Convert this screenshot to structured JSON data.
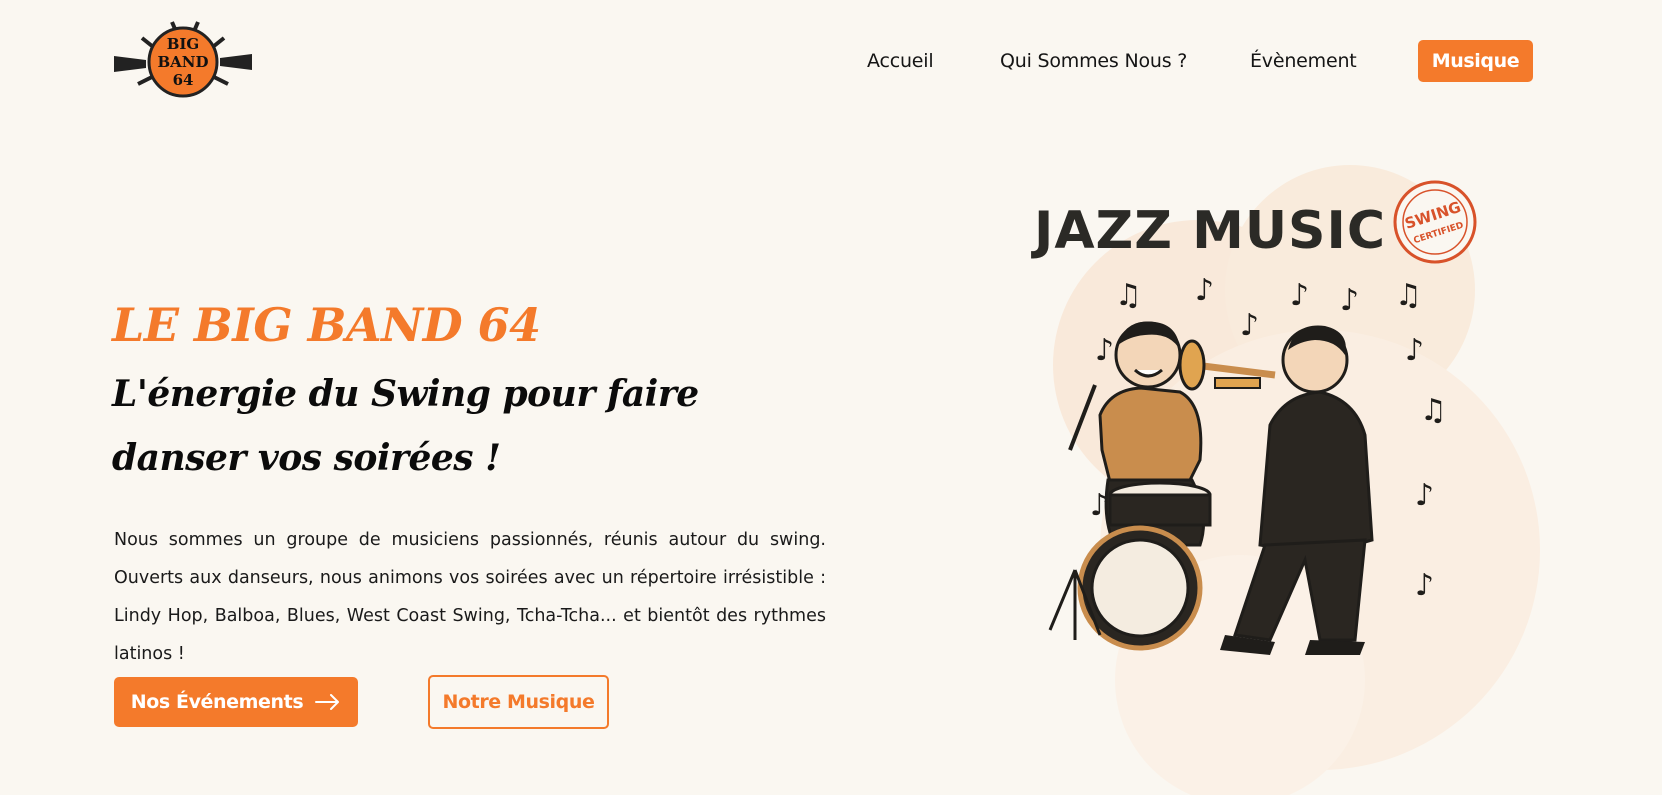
{
  "logo": {
    "line1": "BIG",
    "line2": "BAND",
    "line3": "64"
  },
  "nav": {
    "items": [
      {
        "label": "Accueil"
      },
      {
        "label": "Qui Sommes Nous ?"
      },
      {
        "label": "Évènement"
      }
    ],
    "active_button": "Musique"
  },
  "hero": {
    "title": "LE BIG BAND 64",
    "subtitle": "L'énergie du Swing pour faire danser vos soirées !",
    "description": "Nous sommes un groupe de musiciens passionnés, réunis autour du swing. Ouverts aux danseurs, nous animons vos soirées avec un répertoire irrésistible : Lindy Hop, Balboa, Blues, West Coast Swing, Tcha-Tcha... et bientôt des rythmes latinos !",
    "primary_button": "Nos Événements",
    "secondary_button": "Notre Musique"
  },
  "illustration": {
    "headline": "JAZZ MUSIC",
    "badge_top": "SWING",
    "badge_bottom": "CERTIFIED"
  },
  "colors": {
    "accent": "#f47a2b",
    "background": "#faf7f1",
    "blob": "#f9e9da"
  }
}
